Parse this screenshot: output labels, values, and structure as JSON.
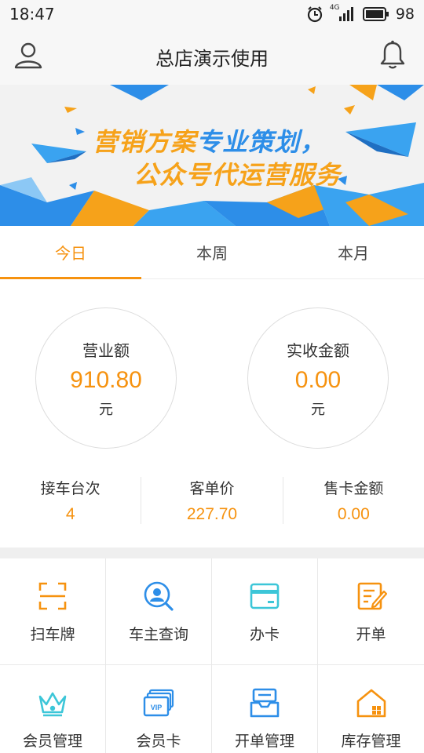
{
  "status": {
    "time": "18:47",
    "network": "4G",
    "battery": "98"
  },
  "header": {
    "title": "总店演示使用"
  },
  "banner": {
    "line1_a": "营销方案",
    "line1_b": "专业策划，",
    "line2": "公众号代运营服务"
  },
  "tabs": [
    {
      "label": "今日",
      "active": true
    },
    {
      "label": "本周",
      "active": false
    },
    {
      "label": "本月",
      "active": false
    }
  ],
  "stats": {
    "revenue": {
      "label": "营业额",
      "value": "910.80",
      "unit": "元"
    },
    "received": {
      "label": "实收金额",
      "value": "0.00",
      "unit": "元"
    },
    "metrics": [
      {
        "label": "接车台次",
        "value": "4"
      },
      {
        "label": "客单价",
        "value": "227.70"
      },
      {
        "label": "售卡金额",
        "value": "0.00"
      }
    ]
  },
  "grid": [
    {
      "label": "扫车牌",
      "icon": "scan-plate-icon"
    },
    {
      "label": "车主查询",
      "icon": "owner-search-icon"
    },
    {
      "label": "办卡",
      "icon": "card-icon"
    },
    {
      "label": "开单",
      "icon": "order-icon"
    },
    {
      "label": "会员管理",
      "icon": "crown-icon"
    },
    {
      "label": "会员卡",
      "icon": "vip-card-icon"
    },
    {
      "label": "开单管理",
      "icon": "order-manage-icon"
    },
    {
      "label": "库存管理",
      "icon": "warehouse-icon"
    }
  ],
  "grid_badge": {
    "vip_text": "VIP"
  },
  "colors": {
    "accent": "#f6920f",
    "blue": "#2d8ee8",
    "teal": "#3cc6d8"
  }
}
